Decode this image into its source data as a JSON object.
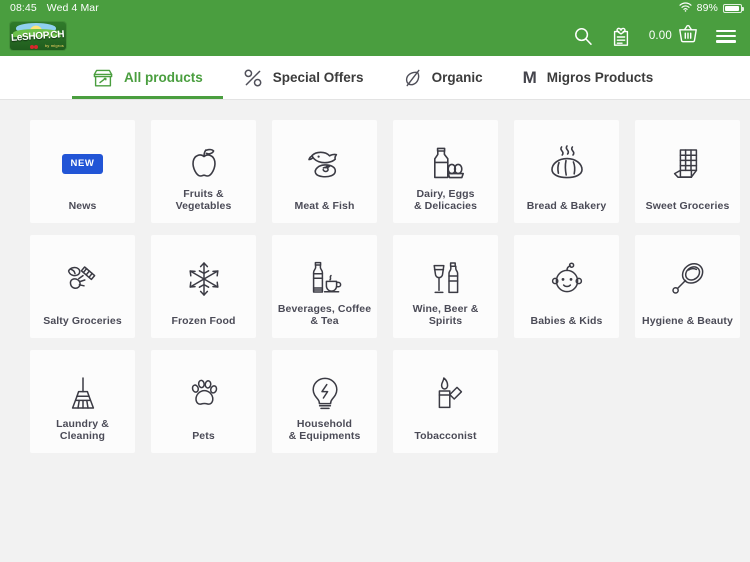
{
  "statusbar": {
    "time": "08:45",
    "date": "Wed 4 Mar",
    "battery_percent": "89%",
    "wifi_icon": "wifi-icon",
    "battery_icon": "battery-icon"
  },
  "header": {
    "logo_text": "LeSHOP.CH",
    "logo_ribbon": "by migros",
    "search_icon": "search-icon",
    "shopping_list_icon": "shopping-list-heart-icon",
    "cart_amount": "0.00",
    "cart_icon": "basket-icon",
    "menu_icon": "hamburger-menu-icon",
    "accent_color": "#4a9e3f"
  },
  "tabs": [
    {
      "label": "All products",
      "icon": "market-stall-icon",
      "active": true
    },
    {
      "label": "Special Offers",
      "icon": "percent-icon",
      "active": false
    },
    {
      "label": "Organic",
      "icon": "leaf-icon",
      "active": false
    },
    {
      "label": "Migros Products",
      "icon": "letter-m-icon",
      "active": false
    }
  ],
  "categories": [
    {
      "lines": [
        "News"
      ],
      "icon": "new-badge",
      "badge": "NEW",
      "badge_color": "#2255d6"
    },
    {
      "lines": [
        "Fruits & Vegetables"
      ],
      "icon": "apple-icon"
    },
    {
      "lines": [
        "Meat & Fish"
      ],
      "icon": "fish-and-steak-icon"
    },
    {
      "lines": [
        "Dairy, Eggs",
        "& Delicacies"
      ],
      "icon": "milk-bottle-eggs-icon"
    },
    {
      "lines": [
        "Bread & Bakery"
      ],
      "icon": "bread-loaf-icon"
    },
    {
      "lines": [
        "Sweet Groceries"
      ],
      "icon": "chocolate-bar-icon"
    },
    {
      "lines": [
        "Salty Groceries"
      ],
      "icon": "chips-snacks-icon"
    },
    {
      "lines": [
        "Frozen Food"
      ],
      "icon": "snowflake-icon"
    },
    {
      "lines": [
        "Beverages, Coffee",
        "& Tea"
      ],
      "icon": "bottle-and-cup-icon"
    },
    {
      "lines": [
        "Wine, Beer & Spirits"
      ],
      "icon": "wine-glass-bottle-icon"
    },
    {
      "lines": [
        "Babies & Kids"
      ],
      "icon": "baby-face-icon"
    },
    {
      "lines": [
        "Hygiene & Beauty"
      ],
      "icon": "hand-mirror-icon"
    },
    {
      "lines": [
        "Laundry & Cleaning"
      ],
      "icon": "broom-icon"
    },
    {
      "lines": [
        "Pets"
      ],
      "icon": "paw-print-icon"
    },
    {
      "lines": [
        "Household",
        "& Equipments"
      ],
      "icon": "light-bulb-icon"
    },
    {
      "lines": [
        "Tobacconist"
      ],
      "icon": "lighter-icon"
    }
  ]
}
